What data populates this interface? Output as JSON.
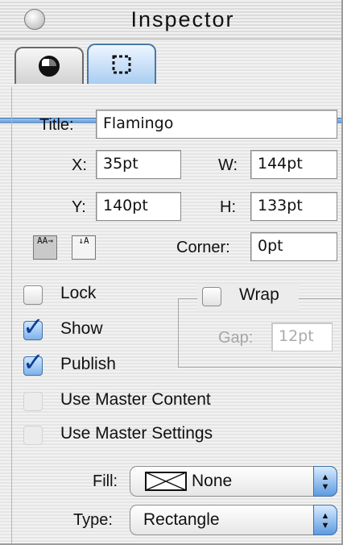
{
  "window": {
    "title": "Inspector"
  },
  "tabs": [
    {
      "icon": "shape-globe-icon",
      "selected": false
    },
    {
      "icon": "marquee-box-icon",
      "selected": true
    }
  ],
  "fields": {
    "title": {
      "label": "Title:",
      "value": "Flamingo"
    },
    "x": {
      "label": "X:",
      "value": "35pt"
    },
    "w": {
      "label": "W:",
      "value": "144pt"
    },
    "y": {
      "label": "Y:",
      "value": "140pt"
    },
    "h": {
      "label": "H:",
      "value": "133pt"
    },
    "corner": {
      "label": "Corner:",
      "value": "0pt"
    }
  },
  "text_direction_buttons": [
    {
      "glyph": "AA→",
      "icon": "text-horizontal-icon",
      "selected": true
    },
    {
      "glyph": "↓A",
      "icon": "text-vertical-icon",
      "selected": false
    }
  ],
  "checkboxes": {
    "lock": {
      "label": "Lock",
      "checked": false
    },
    "show": {
      "label": "Show",
      "checked": true
    },
    "publish": {
      "label": "Publish",
      "checked": true
    },
    "use_master_content": {
      "label": "Use Master Content",
      "checked": false,
      "disabled": true
    },
    "use_master_settings": {
      "label": "Use Master Settings",
      "checked": false,
      "disabled": true
    }
  },
  "wrap": {
    "label": "Wrap",
    "checked": false,
    "gap_label": "Gap:",
    "gap_value": "12pt"
  },
  "fill": {
    "label": "Fill:",
    "value": "None"
  },
  "type": {
    "label": "Type:",
    "value": "Rectangle"
  }
}
